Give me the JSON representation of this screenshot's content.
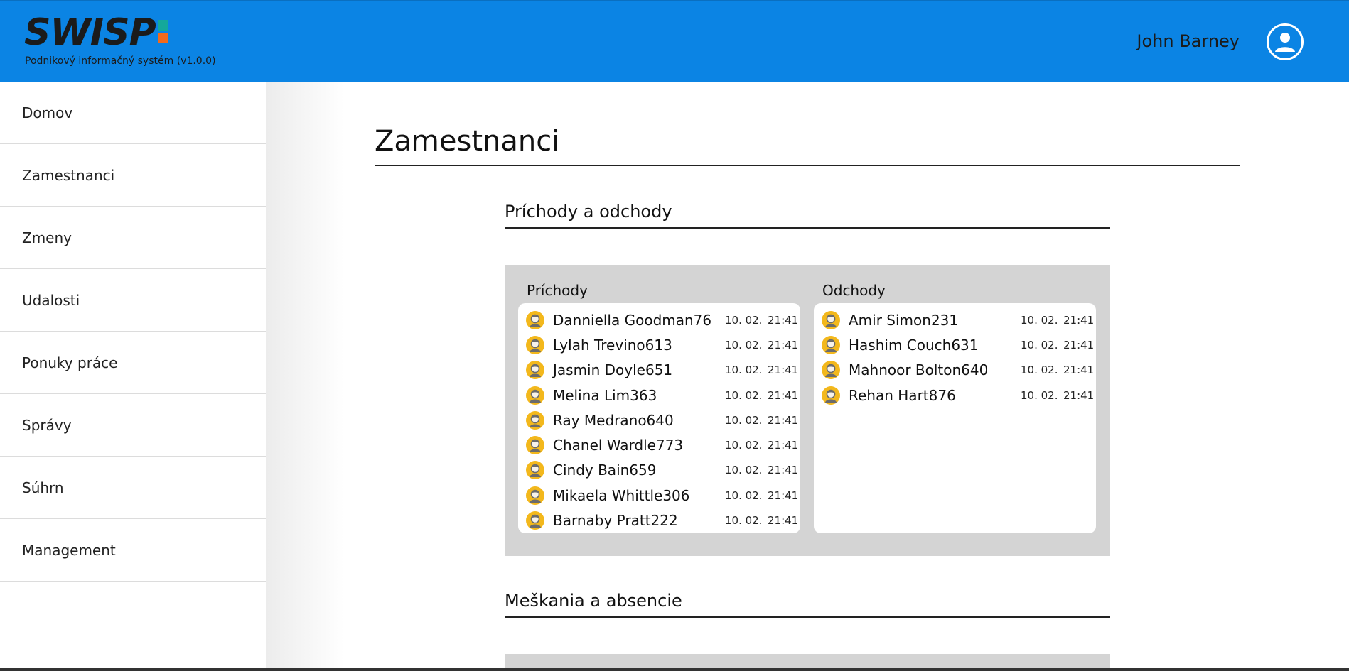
{
  "header": {
    "logo_text": "SWISP",
    "subtitle": "Podnikový informačný systém (v1.0.0)",
    "user_name": "John Barney",
    "colors": {
      "background": "#0b84e4",
      "logo_green": "#14a89a",
      "logo_orange": "#f26a1b"
    },
    "avatar_icon": "user-circle-icon"
  },
  "sidebar": {
    "items": [
      {
        "label": "Domov"
      },
      {
        "label": "Zamestnanci"
      },
      {
        "label": "Zmeny"
      },
      {
        "label": "Udalosti"
      },
      {
        "label": "Ponuky práce"
      },
      {
        "label": "Správy"
      },
      {
        "label": "Súhrn"
      },
      {
        "label": "Management"
      }
    ]
  },
  "main": {
    "title": "Zamestnanci",
    "sections": [
      {
        "title": "Príchody a odchody",
        "arrivals": {
          "title": "Príchody",
          "rows": [
            {
              "name": "Danniella Goodman76",
              "date": "10. 02.",
              "time": "21:41"
            },
            {
              "name": "Lylah Trevino613",
              "date": "10. 02.",
              "time": "21:41"
            },
            {
              "name": "Jasmin Doyle651",
              "date": "10. 02.",
              "time": "21:41"
            },
            {
              "name": "Melina Lim363",
              "date": "10. 02.",
              "time": "21:41"
            },
            {
              "name": "Ray Medrano640",
              "date": "10. 02.",
              "time": "21:41"
            },
            {
              "name": "Chanel Wardle773",
              "date": "10. 02.",
              "time": "21:41"
            },
            {
              "name": "Cindy Bain659",
              "date": "10. 02.",
              "time": "21:41"
            },
            {
              "name": "Mikaela Whittle306",
              "date": "10. 02.",
              "time": "21:41"
            },
            {
              "name": "Barnaby Pratt222",
              "date": "10. 02.",
              "time": "21:41"
            }
          ]
        },
        "departures": {
          "title": "Odchody",
          "rows": [
            {
              "name": "Amir Simon231",
              "date": "10. 02.",
              "time": "21:41"
            },
            {
              "name": "Hashim Couch631",
              "date": "10. 02.",
              "time": "21:41"
            },
            {
              "name": "Mahnoor Bolton640",
              "date": "10. 02.",
              "time": "21:41"
            },
            {
              "name": "Rehan Hart876",
              "date": "10. 02.",
              "time": "21:41"
            }
          ]
        }
      },
      {
        "title": "Meškania a absencie"
      }
    ]
  }
}
